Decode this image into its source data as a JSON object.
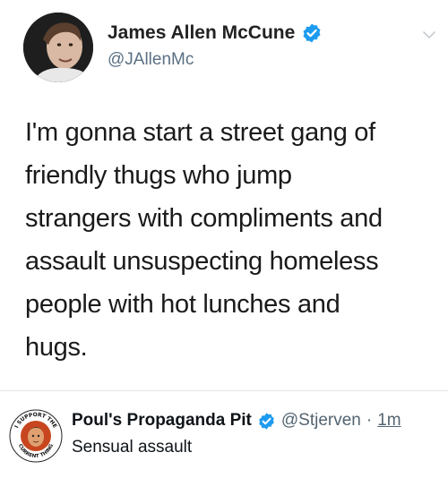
{
  "tweet": {
    "author_name": "James Allen McCune",
    "author_handle": "@JAllenMc",
    "lines": [
      "I'm gonna start a street gang of",
      "friendly thugs who jump",
      "strangers with compliments and",
      "assault unsuspecting homeless",
      "people with hot lunches and",
      "hugs."
    ],
    "verified_icon": "verified-badge-icon",
    "menu_icon": "chevron-down-icon"
  },
  "reply": {
    "author_name": "Poul's Propaganda Pit",
    "author_handle": "@Stjerven",
    "separator": "·",
    "time": "1m",
    "text": "Sensual assault",
    "avatar_ring_top": "I SUPPORT THE",
    "avatar_ring_bottom": "CURRENT THING"
  },
  "colors": {
    "verified_blue": "#1d9bf0",
    "secondary_text": "#536471",
    "divider": "#e1e4e8"
  }
}
